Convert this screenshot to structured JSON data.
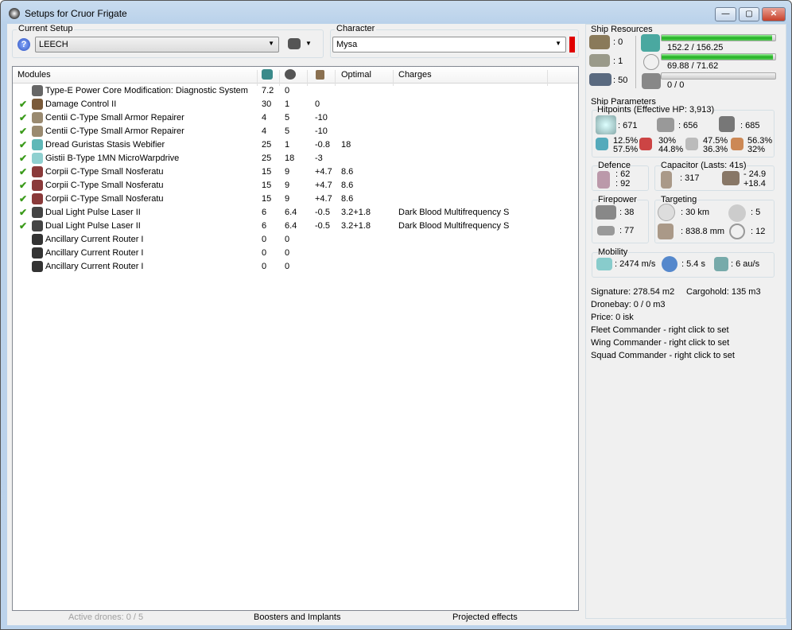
{
  "window": {
    "title": "Setups for Cruor Frigate",
    "min": "—",
    "max": "▢",
    "close": "✕"
  },
  "setup": {
    "label": "Current Setup",
    "value": "LEECH",
    "help": "?"
  },
  "character": {
    "label": "Character",
    "value": "Mysa"
  },
  "modules": {
    "headers": [
      "Modules",
      "",
      "",
      "",
      "Optimal",
      "Charges"
    ],
    "rows": [
      {
        "checked": false,
        "name": "Type-E Power Core Modification: Diagnostic System",
        "icon": "#666",
        "c1": "7.2",
        "c2": "0",
        "c3": "",
        "optimal": "",
        "charges": ""
      },
      {
        "checked": true,
        "name": "Damage Control II",
        "icon": "#7a5a3a",
        "c1": "30",
        "c2": "1",
        "c3": "0",
        "optimal": "",
        "charges": ""
      },
      {
        "checked": true,
        "name": "Centii C-Type Small Armor Repairer",
        "icon": "#9a8a70",
        "c1": "4",
        "c2": "5",
        "c3": "-10",
        "optimal": "",
        "charges": ""
      },
      {
        "checked": true,
        "name": "Centii C-Type Small Armor Repairer",
        "icon": "#9a8a70",
        "c1": "4",
        "c2": "5",
        "c3": "-10",
        "optimal": "",
        "charges": ""
      },
      {
        "checked": true,
        "name": "Dread Guristas Stasis Webifier",
        "icon": "#5fb8b8",
        "c1": "25",
        "c2": "1",
        "c3": "-0.8",
        "optimal": "18",
        "charges": ""
      },
      {
        "checked": true,
        "name": "Gistii B-Type 1MN MicroWarpdrive",
        "icon": "#8fd0d0",
        "c1": "25",
        "c2": "18",
        "c3": "-3",
        "optimal": "",
        "charges": ""
      },
      {
        "checked": true,
        "name": "Corpii C-Type Small Nosferatu",
        "icon": "#8a3a3a",
        "c1": "15",
        "c2": "9",
        "c3": "+4.7",
        "optimal": "8.6",
        "charges": ""
      },
      {
        "checked": true,
        "name": "Corpii C-Type Small Nosferatu",
        "icon": "#8a3a3a",
        "c1": "15",
        "c2": "9",
        "c3": "+4.7",
        "optimal": "8.6",
        "charges": ""
      },
      {
        "checked": true,
        "name": "Corpii C-Type Small Nosferatu",
        "icon": "#8a3a3a",
        "c1": "15",
        "c2": "9",
        "c3": "+4.7",
        "optimal": "8.6",
        "charges": ""
      },
      {
        "checked": true,
        "name": "Dual Light Pulse Laser II",
        "icon": "#444",
        "c1": "6",
        "c2": "6.4",
        "c3": "-0.5",
        "optimal": "3.2+1.8",
        "charges": "Dark Blood Multifrequency S"
      },
      {
        "checked": true,
        "name": "Dual Light Pulse Laser II",
        "icon": "#444",
        "c1": "6",
        "c2": "6.4",
        "c3": "-0.5",
        "optimal": "3.2+1.8",
        "charges": "Dark Blood Multifrequency S"
      },
      {
        "checked": false,
        "name": "Ancillary Current Router I",
        "icon": "#333",
        "c1": "0",
        "c2": "0",
        "c3": "",
        "optimal": "",
        "charges": ""
      },
      {
        "checked": false,
        "name": "Ancillary Current Router I",
        "icon": "#333",
        "c1": "0",
        "c2": "0",
        "c3": "",
        "optimal": "",
        "charges": ""
      },
      {
        "checked": false,
        "name": "Ancillary Current Router I",
        "icon": "#333",
        "c1": "0",
        "c2": "0",
        "c3": "",
        "optimal": "",
        "charges": ""
      }
    ]
  },
  "bottom": {
    "drones": "Active drones: 0 / 5",
    "boosters": "Boosters and Implants",
    "projected": "Projected effects"
  },
  "resources": {
    "label": "Ship Resources",
    "turrets": ": 0",
    "launchers": ": 1",
    "calibration": ": 50",
    "cpu": "152.2 / 156.25",
    "cpu_frac": 0.974,
    "power": "69.88 / 71.62",
    "power_frac": 0.976,
    "drone_bw": "0 / 0",
    "drone_frac": 0
  },
  "params": {
    "label": "Ship Parameters",
    "hp_label": "Hitpoints (Effective HP: 3,913)",
    "shield": ": 671",
    "armor": ": 656",
    "structure": ": 685",
    "em": [
      "12.5%",
      "57.5%"
    ],
    "thermal": [
      "30%",
      "44.8%"
    ],
    "kinetic": [
      "47.5%",
      "36.3%"
    ],
    "explosive": [
      "56.3%",
      "32%"
    ],
    "defence_label": "Defence",
    "def1": ": 62",
    "def2": ": 92",
    "cap_label": "Capacitor (Lasts: 41s)",
    "cap": ": 317",
    "cap_use": "- 24.9",
    "cap_regen": "+18.4",
    "fp_label": "Firepower",
    "fp1": ": 38",
    "fp2": ": 77",
    "tgt_label": "Targeting",
    "range": ": 30 km",
    "targets": ": 5",
    "sensor": ": 838.8 mm",
    "scan": ": 12",
    "mob_label": "Mobility",
    "speed": ": 2474 m/s",
    "align": ": 5.4 s",
    "warp": ": 6 au/s"
  },
  "info": [
    "Signature: 278.54 m2",
    "Cargohold: 135 m3",
    "Dronebay: 0 / 0 m3",
    "Price: 0 isk",
    "Fleet Commander - right click to set",
    "Wing Commander - right click to set",
    "Squad Commander - right click to set"
  ]
}
